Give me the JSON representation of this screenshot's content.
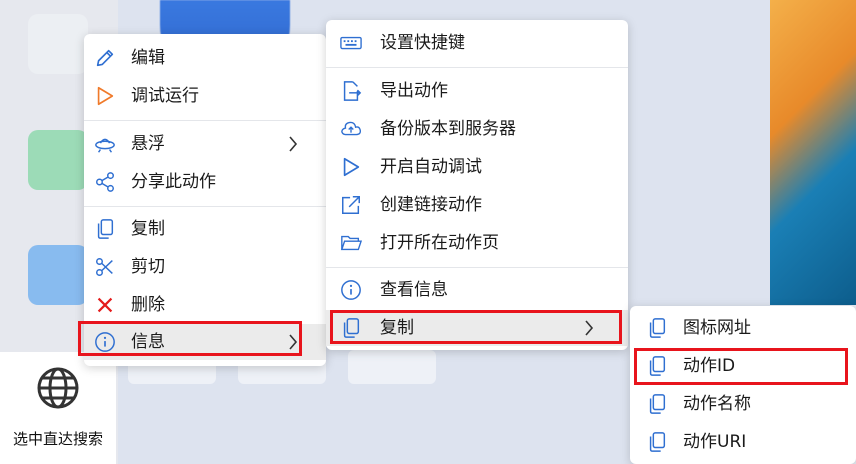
{
  "bottom_tool": {
    "label": "选中直达搜索"
  },
  "menu1": {
    "items": [
      {
        "label": "编辑",
        "icon": "pencil-icon"
      },
      {
        "label": "调试运行",
        "icon": "play-icon"
      },
      {
        "label": "悬浮",
        "icon": "ufo-icon"
      },
      {
        "label": "分享此动作",
        "icon": "share-icon"
      },
      {
        "label": "复制",
        "icon": "copy-icon"
      },
      {
        "label": "剪切",
        "icon": "scissors-icon"
      },
      {
        "label": "删除",
        "icon": "delete-x-icon"
      },
      {
        "label": "信息",
        "icon": "info-icon"
      }
    ]
  },
  "menu2": {
    "items": [
      {
        "label": "设置快捷键",
        "icon": "keyboard-icon"
      },
      {
        "label": "导出动作",
        "icon": "export-icon"
      },
      {
        "label": "备份版本到服务器",
        "icon": "cloud-upload-icon"
      },
      {
        "label": "开启自动调试",
        "icon": "play-icon"
      },
      {
        "label": "创建链接动作",
        "icon": "external-link-icon"
      },
      {
        "label": "打开所在动作页",
        "icon": "folder-icon"
      },
      {
        "label": "查看信息",
        "icon": "info-icon"
      },
      {
        "label": "复制",
        "icon": "copy-icon"
      }
    ]
  },
  "menu3": {
    "items": [
      {
        "label": "图标网址",
        "icon": "copy-icon"
      },
      {
        "label": "动作ID",
        "icon": "copy-icon"
      },
      {
        "label": "动作名称",
        "icon": "copy-icon"
      },
      {
        "label": "动作URI",
        "icon": "copy-icon"
      }
    ]
  },
  "colors": {
    "accent": "#2f6fd1",
    "highlight_box": "#e8141c",
    "play_orange": "#f07a2a",
    "delete_red": "#e41b1b"
  }
}
